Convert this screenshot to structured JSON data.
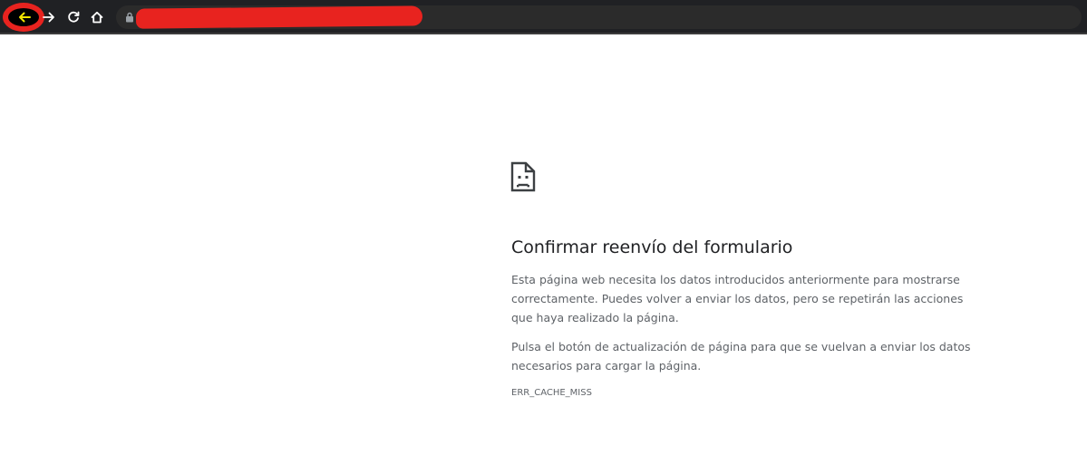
{
  "toolbar": {
    "back_icon": "arrow-left-icon",
    "forward_icon": "arrow-right-icon",
    "reload_icon": "reload-icon",
    "home_icon": "home-icon",
    "lock_icon": "lock-icon",
    "highlight_color": "#e8231f",
    "redaction_color": "#e8231f"
  },
  "error_page": {
    "icon": "sad-document-icon",
    "title": "Confirmar reenvío del formulario",
    "paragraph_1": "Esta página web necesita los datos introducidos anteriormente para mostrarse correctamente. Puedes volver a enviar los datos, pero se repetirán las acciones que haya realizado la página.",
    "paragraph_2": "Pulsa el botón de actualización de página para que se vuelvan a enviar los datos necesarios para cargar la página.",
    "error_code": "ERR_CACHE_MISS"
  }
}
